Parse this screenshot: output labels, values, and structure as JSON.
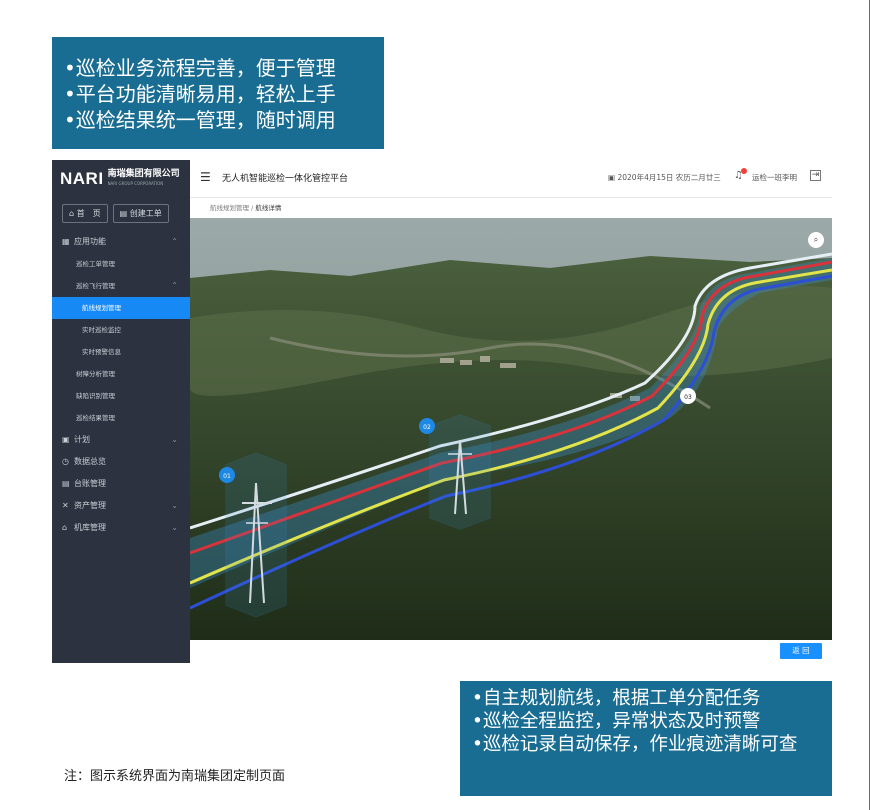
{
  "top_callout": [
    "•巡检业务流程完善，便于管理",
    "•平台功能清晰易用，轻松上手",
    "•巡检结果统一管理，随时调用"
  ],
  "bottom_callout": [
    "•自主规划航线，根据工单分配任务",
    "•巡检全程监控，异常状态及时预警",
    "•巡检记录自动保存，作业痕迹清晰可查"
  ],
  "note": "注：图示系统界面为南瑞集团定制页面",
  "app": {
    "logo_mark": "NARI",
    "logo_text": "南瑞集团有限公司",
    "logo_sub": "NARI GROUP CORPORATION",
    "quick": {
      "home": "首　页",
      "create": "创建工单"
    },
    "menu": [
      {
        "label": "应用功能",
        "level": 0,
        "icon": "grid-icon",
        "chev": "up"
      },
      {
        "label": "巡检工单管理",
        "level": 1
      },
      {
        "label": "巡检飞行管理",
        "level": 1,
        "chev": "up"
      },
      {
        "label": "航线规划管理",
        "level": 2,
        "active": true
      },
      {
        "label": "实时巡检监控",
        "level": 2
      },
      {
        "label": "实时预警信息",
        "level": 2
      },
      {
        "label": "树障分析管理",
        "level": 1
      },
      {
        "label": "缺陷识别管理",
        "level": 1
      },
      {
        "label": "巡检结果管理",
        "level": 1
      },
      {
        "label": "计划",
        "level": 0,
        "icon": "calendar-icon",
        "chev": "down"
      },
      {
        "label": "数据总览",
        "level": 0,
        "icon": "clock-icon"
      },
      {
        "label": "台账管理",
        "level": 0,
        "icon": "ledger-icon"
      },
      {
        "label": "资产管理",
        "level": 0,
        "icon": "asset-icon",
        "chev": "down"
      },
      {
        "label": "机库管理",
        "level": 0,
        "icon": "hangar-icon",
        "chev": "down"
      }
    ],
    "title": "无人机智能巡检一体化管控平台",
    "date": "2020年4月15日 农历二月廿三",
    "user": "运检一班李明",
    "breadcrumb": {
      "parent": "航线规划管理",
      "current": "航线详情"
    },
    "waypoints": [
      "01",
      "02",
      "03"
    ],
    "back_label": "返 回",
    "colors": {
      "sidebar": "#2c3240",
      "active": "#1689f5",
      "callout": "#1a6d92"
    }
  }
}
